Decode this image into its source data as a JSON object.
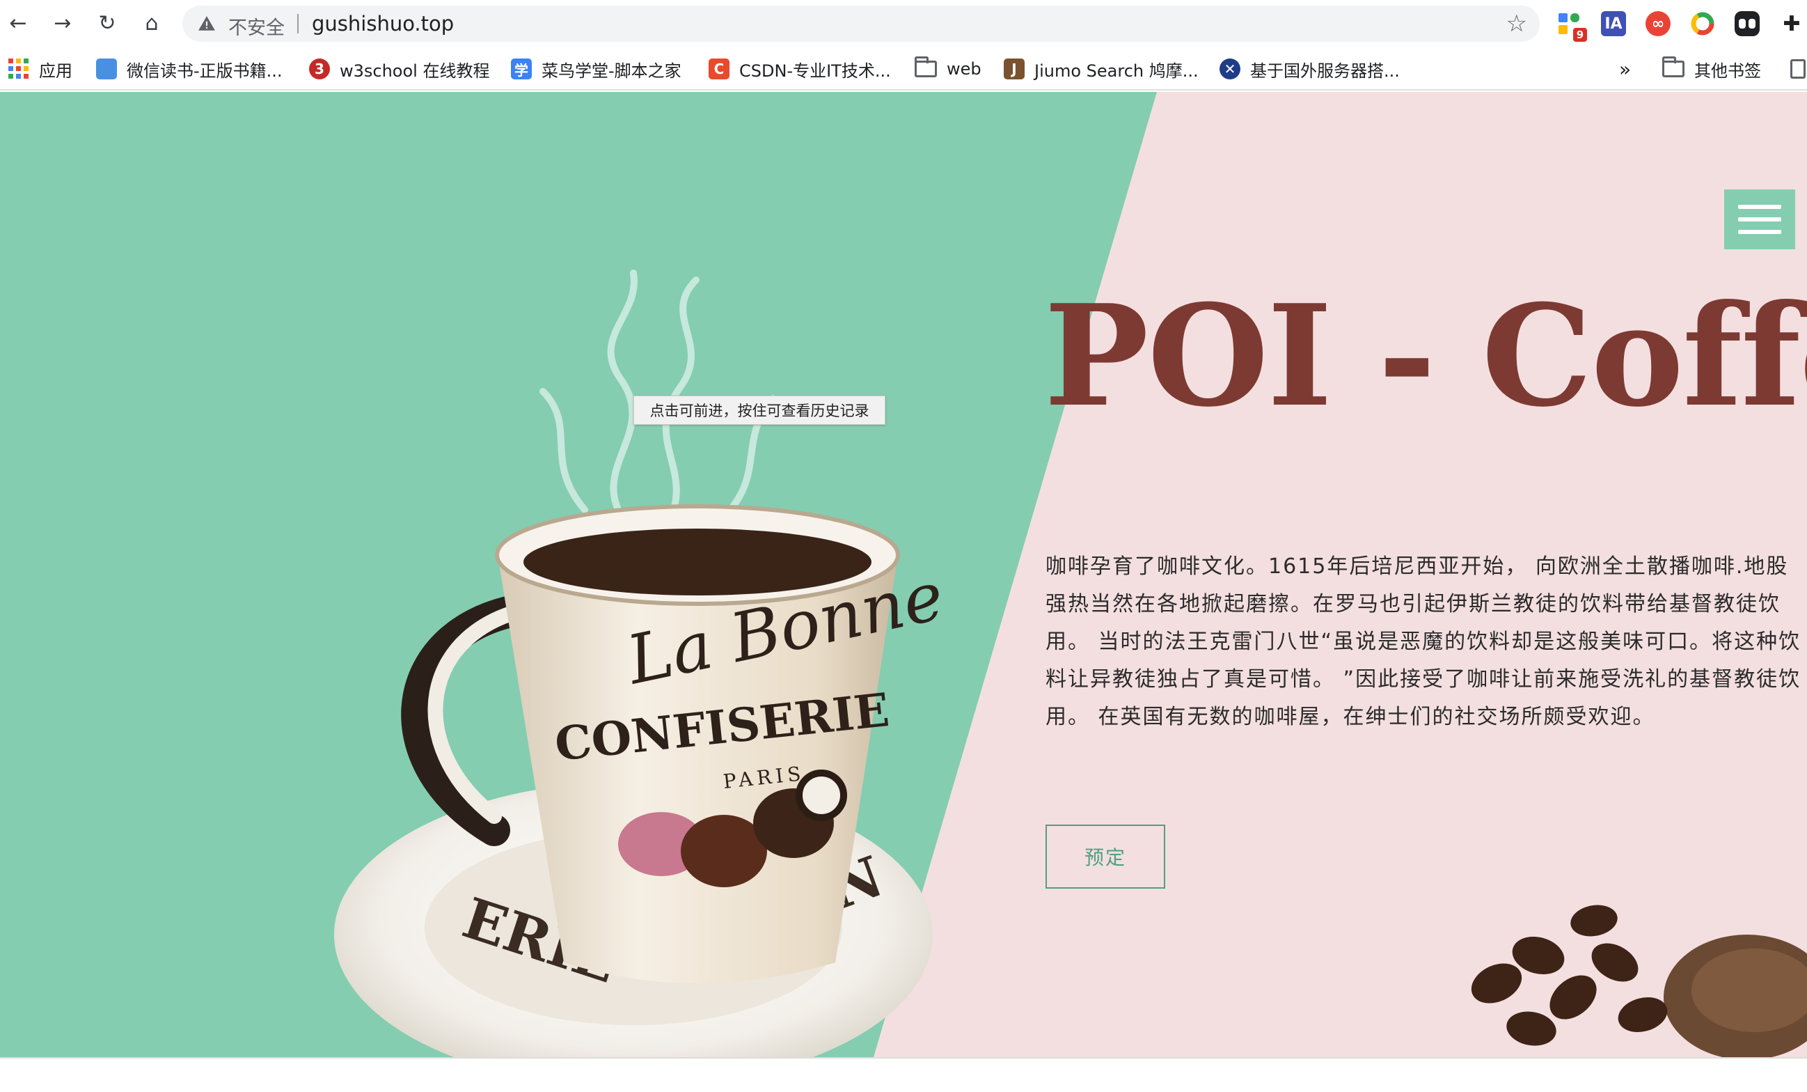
{
  "browser": {
    "nav": {
      "back_icon": "←",
      "forward_icon": "→",
      "reload_icon": "↻",
      "home_icon": "⌂"
    },
    "address_bar": {
      "security_label": "不安全",
      "url": "gushishuo.top",
      "bookmark_star": "☆"
    },
    "extensions": [
      {
        "name": "extension-grid-icon",
        "badge": "9",
        "color": "#4285f4"
      },
      {
        "name": "ia-extension-icon",
        "label": "IA",
        "color": "#3f51b5"
      },
      {
        "name": "infinity-extension-icon",
        "label": "∞",
        "color": "#ea4335"
      },
      {
        "name": "chrome-color-extension-icon",
        "label": "",
        "color": "#fbbc05"
      },
      {
        "name": "game-extension-icon",
        "label": "",
        "color": "#202124"
      },
      {
        "name": "puzzle-extensions-icon",
        "label": "✚",
        "color": "#202124"
      }
    ],
    "bookmarks": [
      {
        "label": "应用",
        "icon": "apps-grid-icon"
      },
      {
        "label": "微信读书-正版书籍...",
        "icon": "weread-icon",
        "color": "#4a90e2",
        "glyph": ""
      },
      {
        "label": "w3school 在线教程",
        "icon": "w3school-icon",
        "color": "#c62828",
        "glyph": "3"
      },
      {
        "label": "菜鸟学堂-脚本之家",
        "icon": "runoob-icon",
        "color": "#3b82f6",
        "glyph": "学"
      },
      {
        "label": "CSDN-专业IT技术...",
        "icon": "csdn-icon",
        "color": "#e84a2c",
        "glyph": "C"
      },
      {
        "label": "web",
        "icon": "folder-icon"
      },
      {
        "label": "Jiumo Search 鸠摩...",
        "icon": "jiumo-icon",
        "color": "#7a5230",
        "glyph": "J"
      },
      {
        "label": "基于国外服务器搭...",
        "icon": "uk-flag-icon",
        "color": "#1f3c88",
        "glyph": "✕"
      }
    ],
    "more_bookmarks": "»",
    "other_bookmarks": "其他书签"
  },
  "page": {
    "title": "POI - Coffee",
    "intro": "咖啡孕育了咖啡文化。1615年后培尼西亚开始， 向欧洲全土散播咖啡.地股强热当然在各地掀起磨擦。在罗马也引起伊斯兰教徒的饮料带给基督教徒饮用。 当时的法王克雷门八世“虽说是恶魔的饮料却是这般美味可口。将这种饮料让异教徒独占了真是可惜。 ”因此接受了咖啡让前来施受洗礼的基督教徒饮用。 在英国有无数的咖啡屋，在绅士们的社交场所颇受欢迎。",
    "book_button": "预定",
    "cup_text": {
      "line1": "La Bonne",
      "line2": "CONFISERIE",
      "line3": "PARIS"
    },
    "colors": {
      "green": "#84cdb1",
      "pink": "#f4dfe0",
      "brown": "#7d3a33"
    }
  },
  "tooltip": "点击可前进，按住可查看历史记录"
}
